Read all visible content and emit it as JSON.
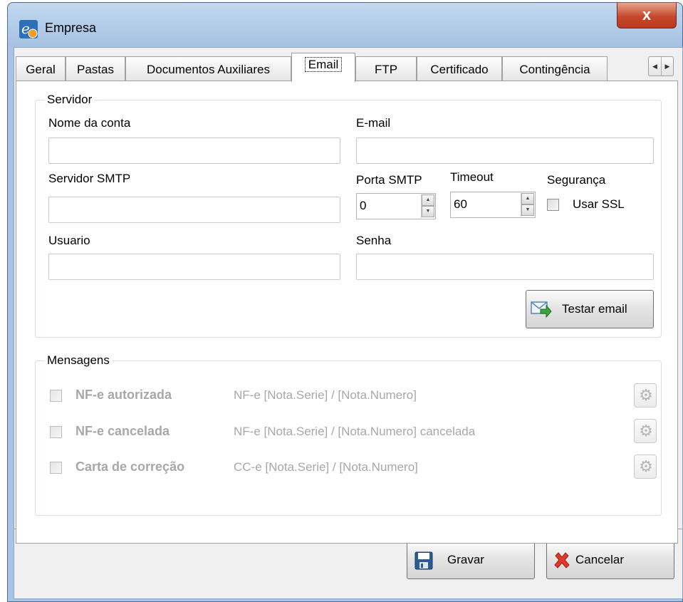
{
  "window": {
    "title": "Empresa",
    "close_label": "x"
  },
  "tabs": [
    {
      "label": "Geral"
    },
    {
      "label": "Pastas"
    },
    {
      "label": "Documentos Auxiliares"
    },
    {
      "label": "Email"
    },
    {
      "label": "FTP"
    },
    {
      "label": "Certificado"
    },
    {
      "label": "Contingência"
    }
  ],
  "active_tab": "Email",
  "servidor": {
    "title": "Servidor",
    "nome_conta_label": "Nome da conta",
    "nome_conta_value": "",
    "email_label": "E-mail",
    "email_value": "",
    "smtp_label": "Servidor SMTP",
    "smtp_value": "",
    "porta_label": "Porta SMTP",
    "porta_value": "0",
    "timeout_label": "Timeout",
    "timeout_value": "60",
    "seguranca_label": "Segurança",
    "ssl_label": "Usar SSL",
    "ssl_checked": false,
    "usuario_label": "Usuario",
    "usuario_value": "",
    "senha_label": "Senha",
    "senha_value": "",
    "testar_label": "Testar email"
  },
  "mensagens": {
    "title": "Mensagens",
    "items": [
      {
        "label": "NF-e autorizada",
        "subject": "NF-e [Nota.Serie] / [Nota.Numero]"
      },
      {
        "label": "NF-e cancelada",
        "subject": "NF-e [Nota.Serie] / [Nota.Numero] cancelada"
      },
      {
        "label": "Carta de correção",
        "subject": "CC-e [Nota.Serie] / [Nota.Numero]"
      }
    ]
  },
  "footer": {
    "gravar_label": "Gravar",
    "cancelar_label": "Cancelar"
  },
  "icons": {
    "app": "app-logo-icon",
    "gear": "gear-icon",
    "save": "floppy-disk-icon",
    "cancel": "red-x-icon",
    "email": "envelope-arrow-icon"
  }
}
